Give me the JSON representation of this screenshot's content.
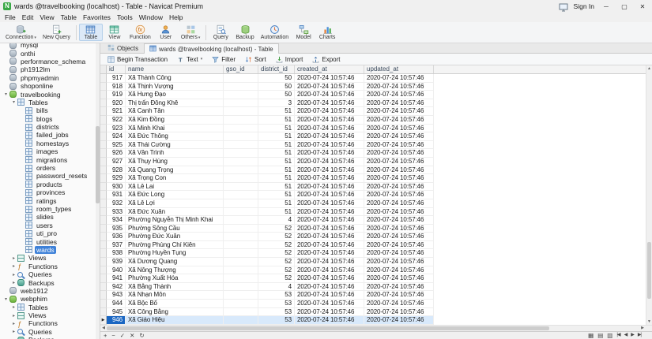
{
  "window": {
    "title": "wards @travelbooking (localhost) - Table - Navicat Premium",
    "sign_in": "Sign In"
  },
  "menu": {
    "items": [
      "File",
      "Edit",
      "View",
      "Table",
      "Favorites",
      "Tools",
      "Window",
      "Help"
    ]
  },
  "main_toolbar": {
    "items": [
      {
        "id": "connection",
        "label": "Connection",
        "dropdown": true
      },
      {
        "id": "new-query",
        "label": "New Query",
        "dropdown": false
      },
      {
        "id": "table",
        "label": "Table",
        "active": true
      },
      {
        "id": "view",
        "label": "View"
      },
      {
        "id": "function",
        "label": "Function"
      },
      {
        "id": "user",
        "label": "User"
      },
      {
        "id": "others",
        "label": "Others",
        "dropdown": true
      },
      {
        "id": "query",
        "label": "Query"
      },
      {
        "id": "backup",
        "label": "Backup"
      },
      {
        "id": "automation",
        "label": "Automation"
      },
      {
        "id": "model",
        "label": "Model"
      },
      {
        "id": "charts",
        "label": "Charts"
      }
    ],
    "separators_after": [
      "new-query",
      "others"
    ]
  },
  "tabs": [
    {
      "id": "objects",
      "label": "Objects",
      "icon": "objects",
      "active": false
    },
    {
      "id": "table-tab",
      "label": "wards @travelbooking (localhost) - Table",
      "icon": "table-tab",
      "active": true
    }
  ],
  "grid_toolbar": {
    "items": [
      {
        "id": "begin-transaction",
        "label": "Begin Transaction"
      },
      {
        "id": "text",
        "label": "Text",
        "dropdown": true
      },
      {
        "id": "filter",
        "label": "Filter"
      },
      {
        "id": "sort",
        "label": "Sort"
      },
      {
        "id": "import",
        "label": "Import"
      },
      {
        "id": "export",
        "label": "Export"
      }
    ]
  },
  "sidebar": {
    "items": [
      {
        "label": "mysql",
        "icon": "db",
        "level": 0
      },
      {
        "label": "onthi",
        "icon": "db",
        "level": 0
      },
      {
        "label": "performance_schema",
        "icon": "db",
        "level": 0
      },
      {
        "label": "ph1912lm",
        "icon": "db",
        "level": 0
      },
      {
        "label": "phpmyadmin",
        "icon": "db",
        "level": 0
      },
      {
        "label": "shoponline",
        "icon": "db",
        "level": 0
      },
      {
        "label": "travelbooking",
        "icon": "db-open",
        "level": 0,
        "arrow": "down"
      },
      {
        "label": "Tables",
        "icon": "tables",
        "level": 1,
        "arrow": "down"
      },
      {
        "label": "bills",
        "icon": "table",
        "level": 2
      },
      {
        "label": "blogs",
        "icon": "table",
        "level": 2
      },
      {
        "label": "districts",
        "icon": "table",
        "level": 2
      },
      {
        "label": "failed_jobs",
        "icon": "table",
        "level": 2
      },
      {
        "label": "homestays",
        "icon": "table",
        "level": 2
      },
      {
        "label": "images",
        "icon": "table",
        "level": 2
      },
      {
        "label": "migrations",
        "icon": "table",
        "level": 2
      },
      {
        "label": "orders",
        "icon": "table",
        "level": 2
      },
      {
        "label": "password_resets",
        "icon": "table",
        "level": 2
      },
      {
        "label": "products",
        "icon": "table",
        "level": 2
      },
      {
        "label": "provinces",
        "icon": "table",
        "level": 2
      },
      {
        "label": "ratings",
        "icon": "table",
        "level": 2
      },
      {
        "label": "room_types",
        "icon": "table",
        "level": 2
      },
      {
        "label": "slides",
        "icon": "table",
        "level": 2
      },
      {
        "label": "users",
        "icon": "table",
        "level": 2
      },
      {
        "label": "uti_pro",
        "icon": "table",
        "level": 2
      },
      {
        "label": "utilities",
        "icon": "table",
        "level": 2
      },
      {
        "label": "wards",
        "icon": "table",
        "level": 2,
        "selected": true
      },
      {
        "label": "Views",
        "icon": "views",
        "level": 1,
        "arrow": "right"
      },
      {
        "label": "Functions",
        "icon": "functions",
        "level": 1,
        "arrow": "right"
      },
      {
        "label": "Queries",
        "icon": "queries",
        "level": 1,
        "arrow": "right"
      },
      {
        "label": "Backups",
        "icon": "backups",
        "level": 1,
        "arrow": "right"
      },
      {
        "label": "web1912",
        "icon": "db",
        "level": 0
      },
      {
        "label": "webphim",
        "icon": "db-open",
        "level": 0,
        "arrow": "down"
      },
      {
        "label": "Tables",
        "icon": "tables",
        "level": 1,
        "arrow": "right"
      },
      {
        "label": "Views",
        "icon": "views",
        "level": 1,
        "arrow": "right"
      },
      {
        "label": "Functions",
        "icon": "functions",
        "level": 1,
        "arrow": "right"
      },
      {
        "label": "Queries",
        "icon": "queries",
        "level": 1,
        "arrow": "right"
      },
      {
        "label": "Backups",
        "icon": "backups",
        "level": 1,
        "arrow": "right"
      }
    ]
  },
  "grid": {
    "columns": [
      "id",
      "name",
      "gso_id",
      "district_id",
      "created_at",
      "updated_at"
    ],
    "selected_row": 29,
    "selected_cell": 0,
    "rows": [
      [
        "917",
        "Xã Thành Công",
        "",
        "50",
        "2020-07-24 10:57:46",
        "2020-07-24 10:57:46"
      ],
      [
        "918",
        "Xã Thịnh Vượng",
        "",
        "50",
        "2020-07-24 10:57:46",
        "2020-07-24 10:57:46"
      ],
      [
        "919",
        "Xã Hưng Đạo",
        "",
        "50",
        "2020-07-24 10:57:46",
        "2020-07-24 10:57:46"
      ],
      [
        "920",
        "Thị trấn Đông Khê",
        "",
        "3",
        "2020-07-24 10:57:46",
        "2020-07-24 10:57:46"
      ],
      [
        "921",
        "Xã Canh Tân",
        "",
        "51",
        "2020-07-24 10:57:46",
        "2020-07-24 10:57:46"
      ],
      [
        "922",
        "Xã Kim Đồng",
        "",
        "51",
        "2020-07-24 10:57:46",
        "2020-07-24 10:57:46"
      ],
      [
        "923",
        "Xã Minh Khai",
        "",
        "51",
        "2020-07-24 10:57:46",
        "2020-07-24 10:57:46"
      ],
      [
        "924",
        "Xã Đức Thông",
        "",
        "51",
        "2020-07-24 10:57:46",
        "2020-07-24 10:57:46"
      ],
      [
        "925",
        "Xã Thái Cường",
        "",
        "51",
        "2020-07-24 10:57:46",
        "2020-07-24 10:57:46"
      ],
      [
        "926",
        "Xã Vân Trình",
        "",
        "51",
        "2020-07-24 10:57:46",
        "2020-07-24 10:57:46"
      ],
      [
        "927",
        "Xã Thụy Hùng",
        "",
        "51",
        "2020-07-24 10:57:46",
        "2020-07-24 10:57:46"
      ],
      [
        "928",
        "Xã Quang Trọng",
        "",
        "51",
        "2020-07-24 10:57:46",
        "2020-07-24 10:57:46"
      ],
      [
        "929",
        "Xã Trọng Con",
        "",
        "51",
        "2020-07-24 10:57:46",
        "2020-07-24 10:57:46"
      ],
      [
        "930",
        "Xã Lê Lai",
        "",
        "51",
        "2020-07-24 10:57:46",
        "2020-07-24 10:57:46"
      ],
      [
        "931",
        "Xã Đức Long",
        "",
        "51",
        "2020-07-24 10:57:46",
        "2020-07-24 10:57:46"
      ],
      [
        "932",
        "Xã Lê Lợi",
        "",
        "51",
        "2020-07-24 10:57:46",
        "2020-07-24 10:57:46"
      ],
      [
        "933",
        "Xã Đức Xuân",
        "",
        "51",
        "2020-07-24 10:57:46",
        "2020-07-24 10:57:46"
      ],
      [
        "934",
        "Phường Nguyễn Thị Minh Khai",
        "",
        "4",
        "2020-07-24 10:57:46",
        "2020-07-24 10:57:46"
      ],
      [
        "935",
        "Phường Sông Cầu",
        "",
        "52",
        "2020-07-24 10:57:46",
        "2020-07-24 10:57:46"
      ],
      [
        "936",
        "Phường Đức Xuân",
        "",
        "52",
        "2020-07-24 10:57:46",
        "2020-07-24 10:57:46"
      ],
      [
        "937",
        "Phường Phùng Chí Kiên",
        "",
        "52",
        "2020-07-24 10:57:46",
        "2020-07-24 10:57:46"
      ],
      [
        "938",
        "Phường Huyền Tụng",
        "",
        "52",
        "2020-07-24 10:57:46",
        "2020-07-24 10:57:46"
      ],
      [
        "939",
        "Xã Dương Quang",
        "",
        "52",
        "2020-07-24 10:57:46",
        "2020-07-24 10:57:46"
      ],
      [
        "940",
        "Xã Nông Thượng",
        "",
        "52",
        "2020-07-24 10:57:46",
        "2020-07-24 10:57:46"
      ],
      [
        "941",
        "Phường Xuất Hóa",
        "",
        "52",
        "2020-07-24 10:57:46",
        "2020-07-24 10:57:46"
      ],
      [
        "942",
        "Xã Bằng Thành",
        "",
        "4",
        "2020-07-24 10:57:46",
        "2020-07-24 10:57:46"
      ],
      [
        "943",
        "Xã Nhạn Môn",
        "",
        "53",
        "2020-07-24 10:57:46",
        "2020-07-24 10:57:46"
      ],
      [
        "944",
        "Xã Bộc Bố",
        "",
        "53",
        "2020-07-24 10:57:46",
        "2020-07-24 10:57:46"
      ],
      [
        "945",
        "Xã Công Bằng",
        "",
        "53",
        "2020-07-24 10:57:46",
        "2020-07-24 10:57:46"
      ],
      [
        "946",
        "Xã Giáo Hiệu",
        "",
        "53",
        "2020-07-24 10:57:46",
        "2020-07-24 10:57:46"
      ]
    ]
  },
  "bottom_bar": {
    "left_icons": [
      "add-record",
      "delete-record",
      "apply-changes",
      "discard-changes",
      "refresh"
    ],
    "right_icons": [
      "grid-view",
      "form-view",
      "memo-view"
    ],
    "nav_icons": [
      "first-record",
      "previous-record",
      "next-record",
      "last-record"
    ]
  },
  "colors": {
    "accent": "#1a66c2",
    "selection": "#3e81d8",
    "selection_light": "#d8e9fb"
  }
}
